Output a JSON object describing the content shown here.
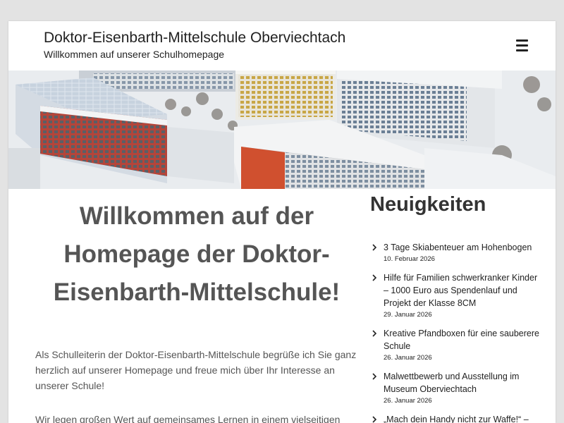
{
  "header": {
    "site_title": "Doktor-Eisenbarth-Mittelschule Oberviechtach",
    "tagline": "Willkommen auf unserer Schulhomepage",
    "menu_icon": "hamburger-menu-icon"
  },
  "main": {
    "heading_lines": [
      "Willkommen auf der",
      "Homepage der Doktor-",
      "Eisenbarth-Mittelschule!"
    ],
    "intro": "Als Schulleiterin der Doktor-Eisenbarth-Mittelschule begrüße ich Sie ganz herzlich auf unserer Homepage und freue mich über Ihr Interesse an unserer Schule!",
    "intro_2": "Wir legen großen Wert auf gemeinsames Lernen in einem vielseitigen"
  },
  "sidebar": {
    "title": "Neuigkeiten",
    "news": [
      {
        "title": "3 Tage Skiabenteuer am Hohenbogen",
        "date": "10. Februar 2026"
      },
      {
        "title": "Hilfe für Familien schwerkranker Kinder – 1000 Euro aus Spendenlauf und Projekt der Klasse 8CM",
        "date": "29. Januar 2026"
      },
      {
        "title": "Kreative Pfandboxen für eine sauberere Schule",
        "date": "26. Januar 2026"
      },
      {
        "title": "Malwettbewerb und Ausstellung im Museum Oberviechtach",
        "date": "26. Januar 2026"
      },
      {
        "title": "„Mach dein Handy nicht zur Waffe!“ –",
        "date": ""
      }
    ]
  },
  "colors": {
    "page_background": "#e3e3e3",
    "content_background": "#ffffff",
    "heading_text": "#555555",
    "body_text": "#555555",
    "dark_text": "#222222"
  }
}
